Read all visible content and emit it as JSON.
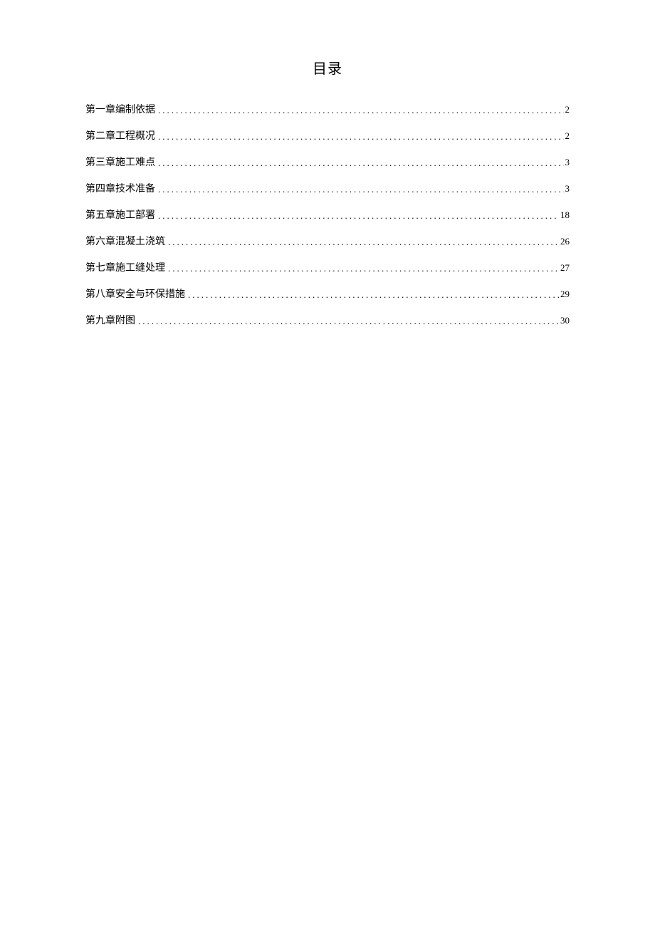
{
  "title": "目录",
  "toc": [
    {
      "label": "第一章编制依据",
      "page": "2"
    },
    {
      "label": "第二章工程概况",
      "page": "2"
    },
    {
      "label": "第三章施工难点",
      "page": "3"
    },
    {
      "label": "第四章技术准备",
      "page": "3"
    },
    {
      "label": "第五章施工部署",
      "page": "18"
    },
    {
      "label": "第六章混凝土浇筑",
      "page": "26"
    },
    {
      "label": "第七章施工缝处理",
      "page": "27"
    },
    {
      "label": "第八章安全与环保措施",
      "page": "29"
    },
    {
      "label": "第九章附图",
      "page": "30"
    }
  ]
}
